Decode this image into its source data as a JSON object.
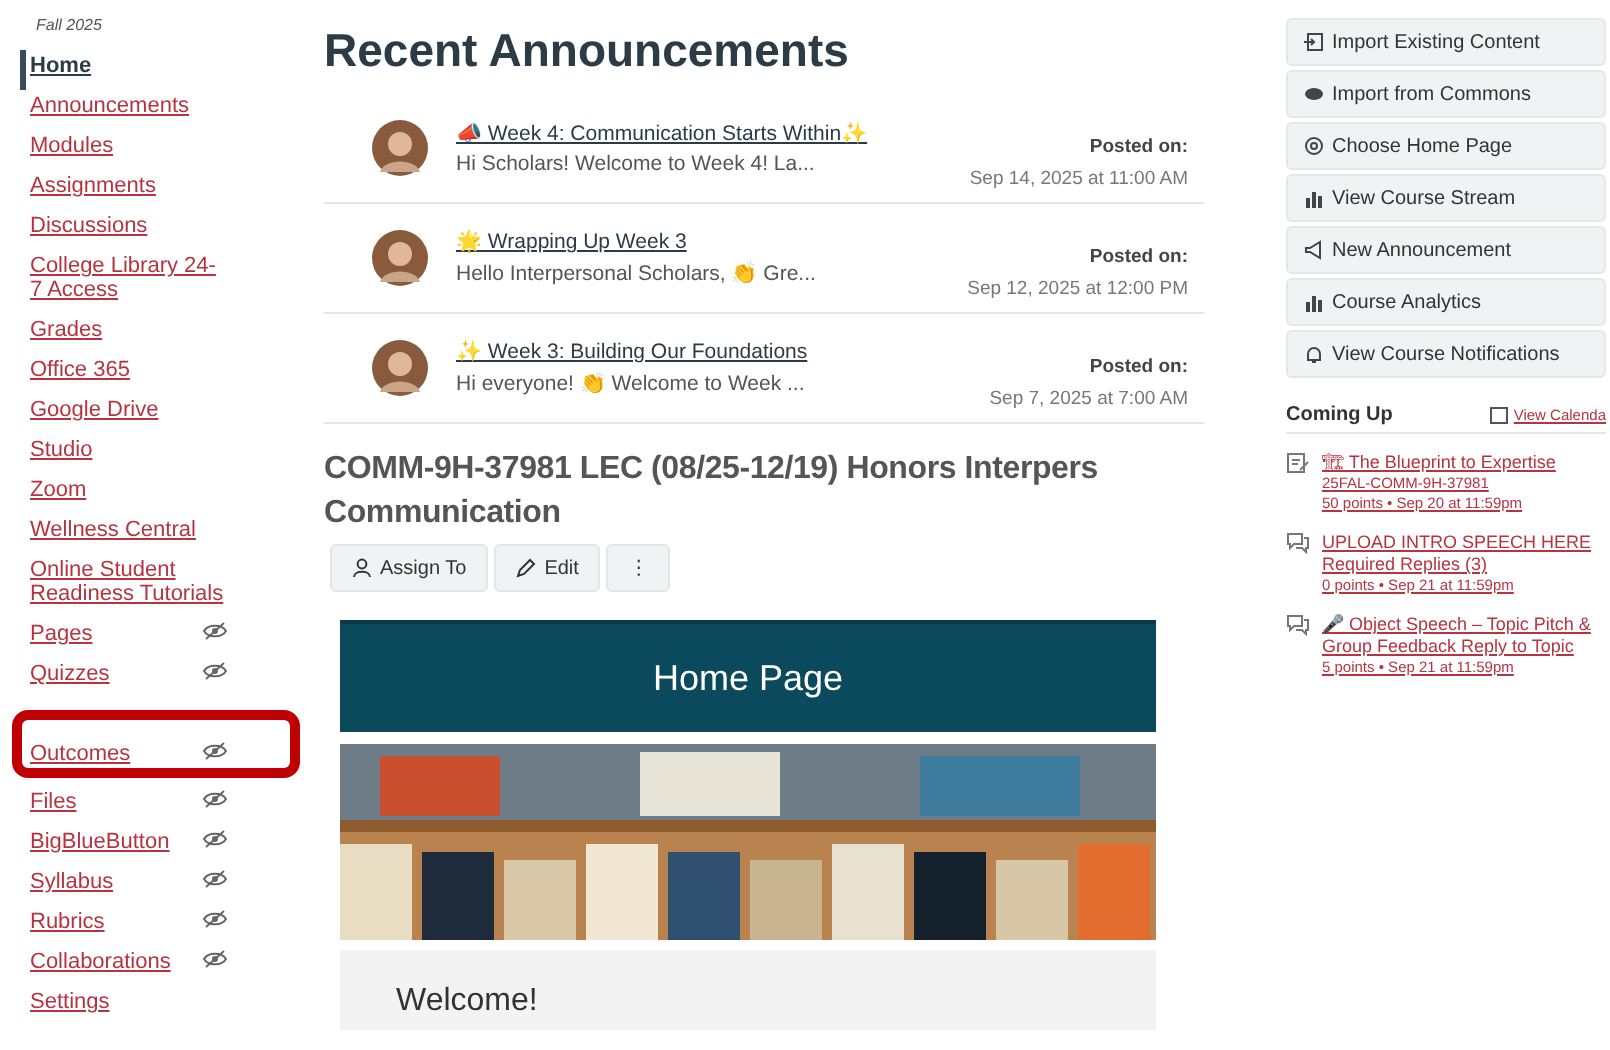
{
  "term": "Fall 2025",
  "nav": [
    {
      "label": "Home",
      "selected": true,
      "hidden": false
    },
    {
      "label": "Announcements",
      "selected": false,
      "hidden": false
    },
    {
      "label": "Modules",
      "selected": false,
      "hidden": false
    },
    {
      "label": "Assignments",
      "selected": false,
      "hidden": false
    },
    {
      "label": "Discussions",
      "selected": false,
      "hidden": false
    },
    {
      "label": "College Library 24-7 Access",
      "selected": false,
      "hidden": false
    },
    {
      "label": "Grades",
      "selected": false,
      "hidden": false
    },
    {
      "label": "Office 365",
      "selected": false,
      "hidden": false
    },
    {
      "label": "Google Drive",
      "selected": false,
      "hidden": false
    },
    {
      "label": "Studio",
      "selected": false,
      "hidden": false
    },
    {
      "label": "Zoom",
      "selected": false,
      "hidden": false
    },
    {
      "label": "Wellness Central",
      "selected": false,
      "hidden": false
    },
    {
      "label": "Online Student Readiness Tutorials",
      "selected": false,
      "hidden": false
    },
    {
      "label": "Pages",
      "selected": false,
      "hidden": true
    },
    {
      "label": "Quizzes",
      "selected": false,
      "hidden": true
    },
    {
      "label": "Outcomes",
      "selected": false,
      "hidden": true,
      "circled": true
    },
    {
      "label": "Files",
      "selected": false,
      "hidden": true
    },
    {
      "label": "BigBlueButton",
      "selected": false,
      "hidden": true
    },
    {
      "label": "Syllabus",
      "selected": false,
      "hidden": true
    },
    {
      "label": "Rubrics",
      "selected": false,
      "hidden": true
    },
    {
      "label": "Collaborations",
      "selected": false,
      "hidden": true
    },
    {
      "label": "Settings",
      "selected": false,
      "hidden": false
    }
  ],
  "announcements_title": "Recent Announcements",
  "announcements": [
    {
      "title": "📣 Week 4: Communication Starts Within✨",
      "preview": "Hi Scholars! Welcome to Week 4! La...",
      "posted_label": "Posted on:",
      "date": "Sep 14, 2025 at 11:00 AM"
    },
    {
      "title": "🌟 Wrapping Up Week 3",
      "preview": "Hello Interpersonal Scholars, 👏 Gre...",
      "posted_label": "Posted on:",
      "date": "Sep 12, 2025 at 12:00 PM"
    },
    {
      "title": "✨ Week 3: Building Our Foundations",
      "preview": "Hi everyone! 👏 Welcome to Week ...",
      "posted_label": "Posted on:",
      "date": "Sep 7, 2025 at 7:00 AM"
    }
  ],
  "course_title": "COMM-9H-37981 LEC (08/25-12/19) Honors Interpers Communication",
  "page_buttons": [
    {
      "kind": "assign",
      "label": "Assign To"
    },
    {
      "kind": "edit",
      "label": "Edit"
    },
    {
      "kind": "more",
      "label": "⋮"
    }
  ],
  "banner_title": "Home Page",
  "welcome": "Welcome!",
  "actions": [
    {
      "kind": "import",
      "label": "Import Existing Content"
    },
    {
      "kind": "commons",
      "label": "Import from Commons"
    },
    {
      "kind": "home",
      "label": "Choose Home Page"
    },
    {
      "kind": "chart",
      "label": "View Course Stream"
    },
    {
      "kind": "megaphone",
      "label": "New Announcement"
    },
    {
      "kind": "chart",
      "label": "Course Analytics"
    },
    {
      "kind": "bell",
      "label": "View Course Notifications"
    }
  ],
  "coming_up": {
    "title": "Coming Up",
    "calendar_link": "View Calenda",
    "items": [
      {
        "kind": "assignment",
        "title": "🏗 The Blueprint to Expertise",
        "course": "25FAL-COMM-9H-37981",
        "meta": "50 points • Sep 20 at 11:59pm"
      },
      {
        "kind": "discussion",
        "title": "UPLOAD INTRO SPEECH HERE Required Replies (3)",
        "meta": "0 points • Sep 21 at 11:59pm"
      },
      {
        "kind": "discussion",
        "title": "🎤 Object Speech – Topic Pitch & Group Feedback Reply to Topic",
        "meta": "5 points • Sep 21 at 11:59pm"
      }
    ]
  }
}
